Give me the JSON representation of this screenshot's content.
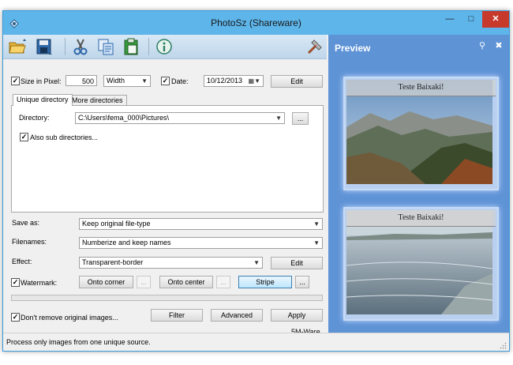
{
  "window": {
    "title": "PhotoSz (Shareware)"
  },
  "toolbar": {
    "icons": [
      "open-folder-icon",
      "save-icon",
      "cut-icon",
      "copy-icon",
      "paste-icon",
      "info-icon",
      "hammer-icon"
    ]
  },
  "options": {
    "size_in_pixel": {
      "label": "Size in Pixel:",
      "checked": true,
      "value": "500"
    },
    "dimension": {
      "selected": "Width"
    },
    "date": {
      "label": "Date:",
      "checked": true,
      "value": "10/12/2013"
    },
    "edit_label": "Edit"
  },
  "tabs": [
    {
      "label": "Unique directory",
      "active": true
    },
    {
      "label": "More directories",
      "active": false
    }
  ],
  "directory": {
    "label": "Directory:",
    "value": "C:\\Users\\fema_000\\Pictures\\",
    "browse_label": "...",
    "subdirs_label": "Also sub directories...",
    "subdirs_checked": true
  },
  "save_as": {
    "label": "Save as:",
    "selected": "Keep original file-type"
  },
  "filenames": {
    "label": "Filenames:",
    "selected": "Numberize and keep names"
  },
  "effect": {
    "label": "Effect:",
    "selected": "Transparent-border",
    "edit_label": "Edit"
  },
  "watermark": {
    "label": "Watermark:",
    "checked": true,
    "onto_corner": "Onto corner",
    "onto_center": "Onto center",
    "stripe": "Stripe",
    "more_label": "..."
  },
  "bottom": {
    "keep_originals_label": "Don't remove original images...",
    "keep_originals_checked": true,
    "filter_label": "Filter",
    "advanced_label": "Advanced",
    "apply_label": "Apply",
    "brand": "5M-Ware"
  },
  "status": {
    "text": "Process only images from one unique source."
  },
  "preview": {
    "title": "Preview",
    "watermark_top": "Teste Baixaki!",
    "watermark_bottom": "Teste Baixaki!"
  },
  "colors": {
    "titlebar": "#5db5ea",
    "preview_bg": "#5e93d6",
    "close": "#c7392b"
  }
}
